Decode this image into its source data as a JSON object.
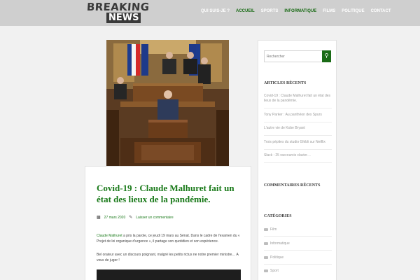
{
  "header": {
    "logo_line1": "BREAKING",
    "logo_line2": "NEWS",
    "nav": [
      "QUI SUIS-JE ?",
      "ACCUEIL",
      "SPORTS",
      "INFORMATIQUE",
      "FILMS",
      "POLITIQUE",
      "CONTACT"
    ],
    "active_nav": "INFORMATIQUE",
    "accent_color": "#1a6b16"
  },
  "post": {
    "title": "Covid-19 : Claude Malhuret fait un état des lieux de la pandémie.",
    "date": "27 mars 2020",
    "comment_link": "Laisser un commentaire",
    "paragraph1_link": "Claude Malhuret",
    "paragraph1_text": " a pris la parole, ce jeudi 19 mars au Sénat. Dans le cadre de l'examen du « Projet de loi organique d'urgence », il partage son quotidien et son expérience.",
    "paragraph2": "Bel orateur avec un discours poignant, malgré les petits rictus ne notre premier ministre… A vous de juger !"
  },
  "sidebar": {
    "search_placeholder": "Rechercher",
    "recent_articles_heading": "ARTICLES RÉCENTS",
    "recent_articles": [
      "Covid-19 : Claude Malhuret fait un état des lieux de la pandémie.",
      "Tony Parker : Au panthéon des Spurs",
      "L'autre vie de Kobe Bryant",
      "Trois pépites du studio Ghibli sur Netflix",
      "Slack : 25 raccourcis clavier…"
    ],
    "recent_comments_heading": "COMMENTAIRES RÉCENTS",
    "categories_heading": "CATÉGORIES",
    "categories": [
      "Film",
      "Informatique",
      "Politique",
      "Sport"
    ]
  }
}
